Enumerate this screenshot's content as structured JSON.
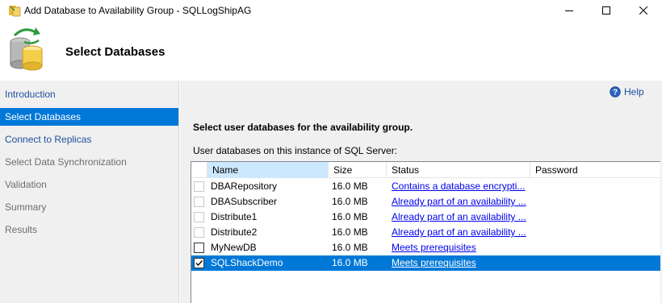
{
  "window": {
    "title": "Add Database to Availability Group - SQLLogShipAG",
    "minimize_icon": "minimize-icon",
    "maximize_icon": "maximize-icon",
    "close_icon": "close-icon"
  },
  "header": {
    "title": "Select Databases",
    "icon": "database-sync-icon"
  },
  "nav": {
    "items": [
      {
        "label": "Introduction",
        "state": "link"
      },
      {
        "label": "Select Databases",
        "state": "selected"
      },
      {
        "label": "Connect to Replicas",
        "state": "link"
      },
      {
        "label": "Select Data Synchronization",
        "state": "disabled"
      },
      {
        "label": "Validation",
        "state": "disabled"
      },
      {
        "label": "Summary",
        "state": "disabled"
      },
      {
        "label": "Results",
        "state": "disabled"
      }
    ]
  },
  "main": {
    "help_label": "Help",
    "instructions": "Select user databases for the availability group.",
    "grid_label": "User databases on this instance of SQL Server:",
    "columns": [
      "Name",
      "Size",
      "Status",
      "Password"
    ],
    "rows": [
      {
        "name": "DBARepository",
        "size": "16.0 MB",
        "status": "Contains a database encrypti...",
        "checked": false,
        "enabled": false,
        "selected": false
      },
      {
        "name": "DBASubscriber",
        "size": "16.0 MB",
        "status": "Already part of an availability ...",
        "checked": false,
        "enabled": false,
        "selected": false
      },
      {
        "name": "Distribute1",
        "size": "16.0 MB",
        "status": "Already part of an availability ...",
        "checked": false,
        "enabled": false,
        "selected": false
      },
      {
        "name": "Distribute2",
        "size": "16.0 MB",
        "status": "Already part of an availability ...",
        "checked": false,
        "enabled": false,
        "selected": false
      },
      {
        "name": "MyNewDB",
        "size": "16.0 MB",
        "status": "Meets prerequisites",
        "checked": false,
        "enabled": true,
        "selected": false
      },
      {
        "name": "SQLShackDemo",
        "size": "16.0 MB",
        "status": "Meets prerequisites",
        "checked": true,
        "enabled": true,
        "selected": true
      }
    ]
  },
  "colors": {
    "accent": "#0078d7",
    "link": "#1c4f9c",
    "nav_background": "#f0f0f0",
    "header_highlight": "#cce8ff"
  }
}
